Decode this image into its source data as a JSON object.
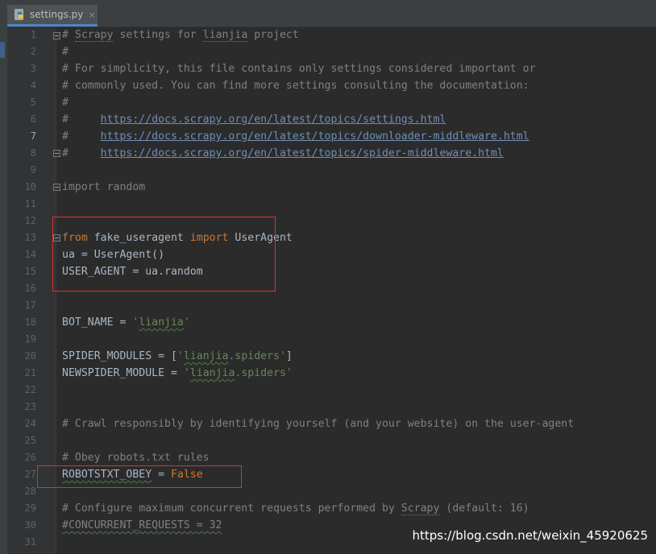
{
  "tab": {
    "filename": "settings.py",
    "close": "×",
    "icon": "python-file-icon"
  },
  "current_line": 7,
  "line_numbers": [
    "1",
    "2",
    "3",
    "4",
    "5",
    "6",
    "7",
    "8",
    "9",
    "10",
    "11",
    "12",
    "13",
    "14",
    "15",
    "16",
    "17",
    "18",
    "19",
    "20",
    "21",
    "22",
    "23",
    "24",
    "25",
    "26",
    "27",
    "28",
    "29",
    "30",
    "31"
  ],
  "code": {
    "l1_a": "# ",
    "l1_scrapy": "Scrapy",
    "l1_b": " settings for ",
    "l1_lianjia": "lianjia",
    "l1_c": " project",
    "l2": "#",
    "l3": "# For simplicity, this file contains only settings considered important or",
    "l4": "# commonly used. You can find more settings consulting the documentation:",
    "l5": "#",
    "l6_hash": "#     ",
    "l6_url": "https://docs.scrapy.org/en/latest/topics/settings.html",
    "l7_hash": "#     ",
    "l7_url": "https://docs.scrapy.org/en/latest/topics/downloader-middleware.html",
    "l8_hash": "#     ",
    "l8_url": "https://docs.scrapy.org/en/latest/topics/spider-middleware.html",
    "l10_kw": "import",
    "l10_rest": " random",
    "l13_from": "from",
    "l13_mod": " fake_useragent ",
    "l13_import": "import",
    "l13_name": " UserAgent",
    "l14": "ua = UserAgent()",
    "l15": "USER_AGENT = ua.random",
    "l18_a": "BOT_NAME = ",
    "l18_q1": "'",
    "l18_s": "lianjia",
    "l18_q2": "'",
    "l20_a": "SPIDER_MODULES = [",
    "l20_q1": "'",
    "l20_s": "lianjia",
    "l20_s2": ".spiders'",
    "l20_b": "]",
    "l21_a": "NEWSPIDER_MODULE = ",
    "l21_q1": "'",
    "l21_s": "lianjia",
    "l21_s2": ".spiders'",
    "l24": "# Crawl responsibly by identifying yourself (and your website) on the user-agent",
    "l26": "# Obey robots.txt rules",
    "l27_a": "ROBOTSTXT_OBEY",
    "l27_b": " = ",
    "l27_c": "False",
    "l29_a": "# Configure maximum concurrent requests performed by ",
    "l29_scrapy": "Scrapy",
    "l29_b": " (default: 16)",
    "l30": "#CONCURRENT_REQUESTS = 32"
  },
  "watermark": "https://blog.csdn.net/weixin_45920625",
  "colors": {
    "background": "#2b2b2b",
    "gutter": "#313335",
    "keyword": "#cc7832",
    "string": "#6a8759",
    "comment": "#808080",
    "highlight_box": "#e03030"
  }
}
